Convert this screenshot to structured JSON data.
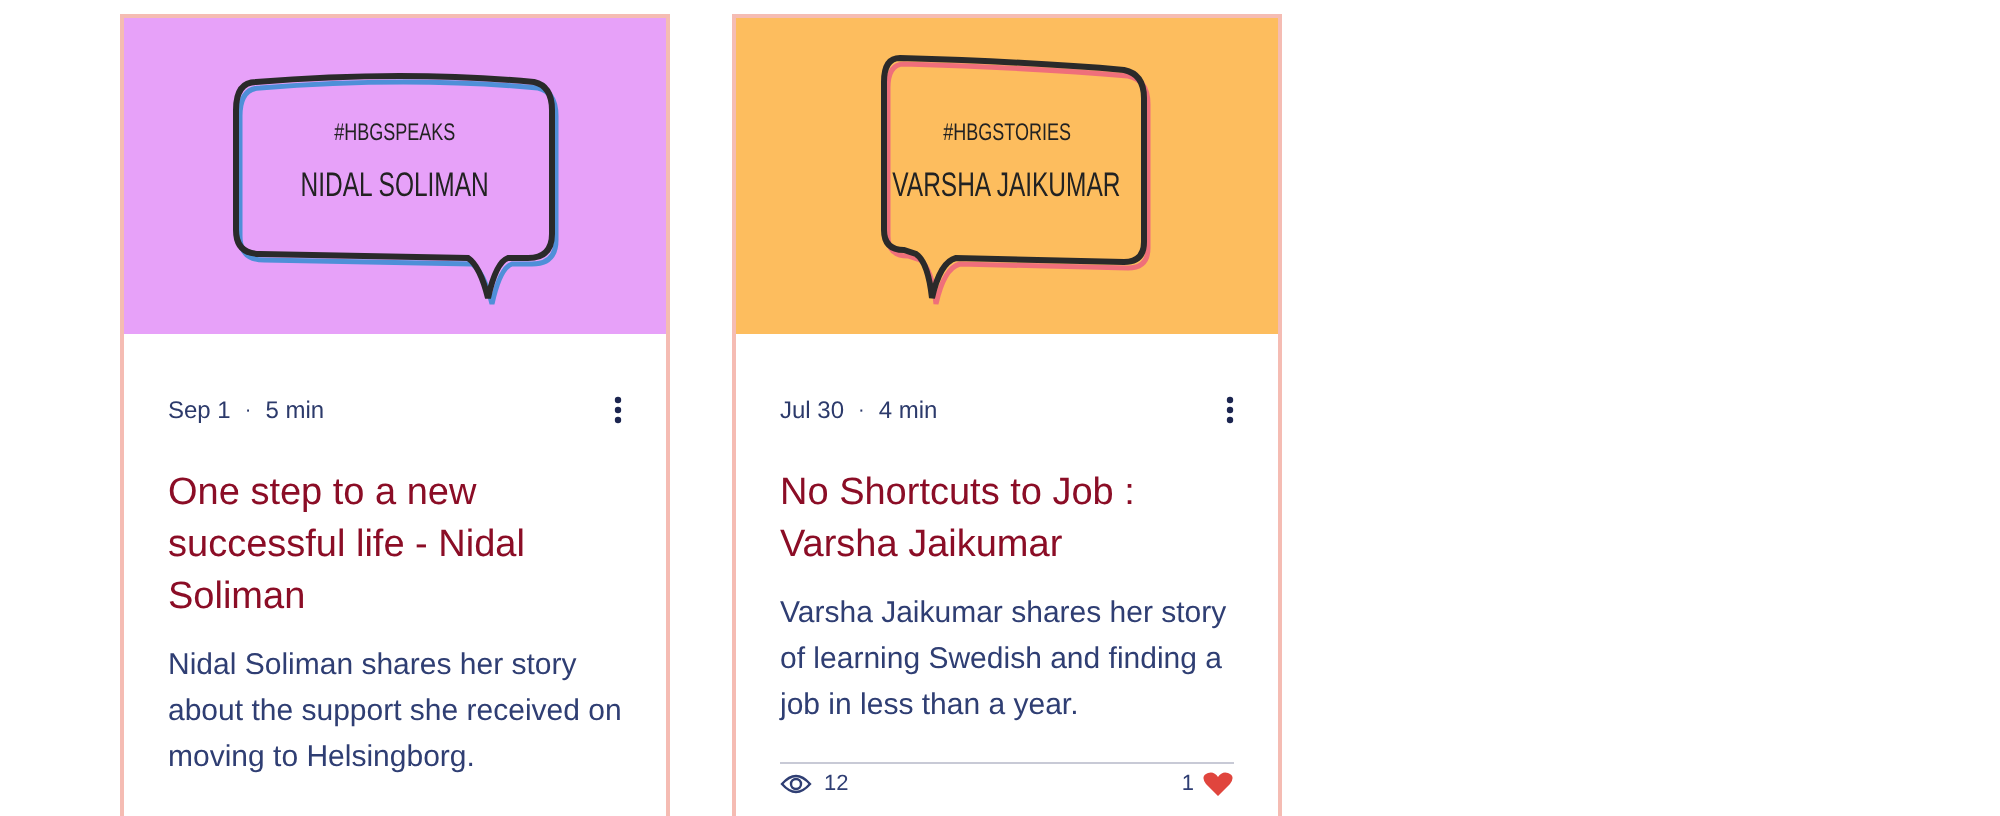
{
  "posts": [
    {
      "cover": {
        "color": "#e7a1f9",
        "tag": "#HBGSPEAKS",
        "name": "NIDAL SOLIMAN"
      },
      "date": "Sep 1",
      "separator": "·",
      "read_time": "5 min",
      "title": "One step to a new successful life - Nidal Soliman",
      "excerpt": "Nidal Soliman shares her story about the support she received on moving to Helsingborg."
    },
    {
      "cover": {
        "color": "#fdbd5e",
        "tag": "#HBGSTORIES",
        "name": "VARSHA JAIKUMAR"
      },
      "date": "Jul 30",
      "separator": "·",
      "read_time": "4 min",
      "title": "No Shortcuts to Job : Varsha Jaikumar",
      "excerpt": "Varsha Jaikumar shares her story of learning Swedish and finding a job in less than a year.",
      "views": "12",
      "likes": "1"
    }
  ]
}
